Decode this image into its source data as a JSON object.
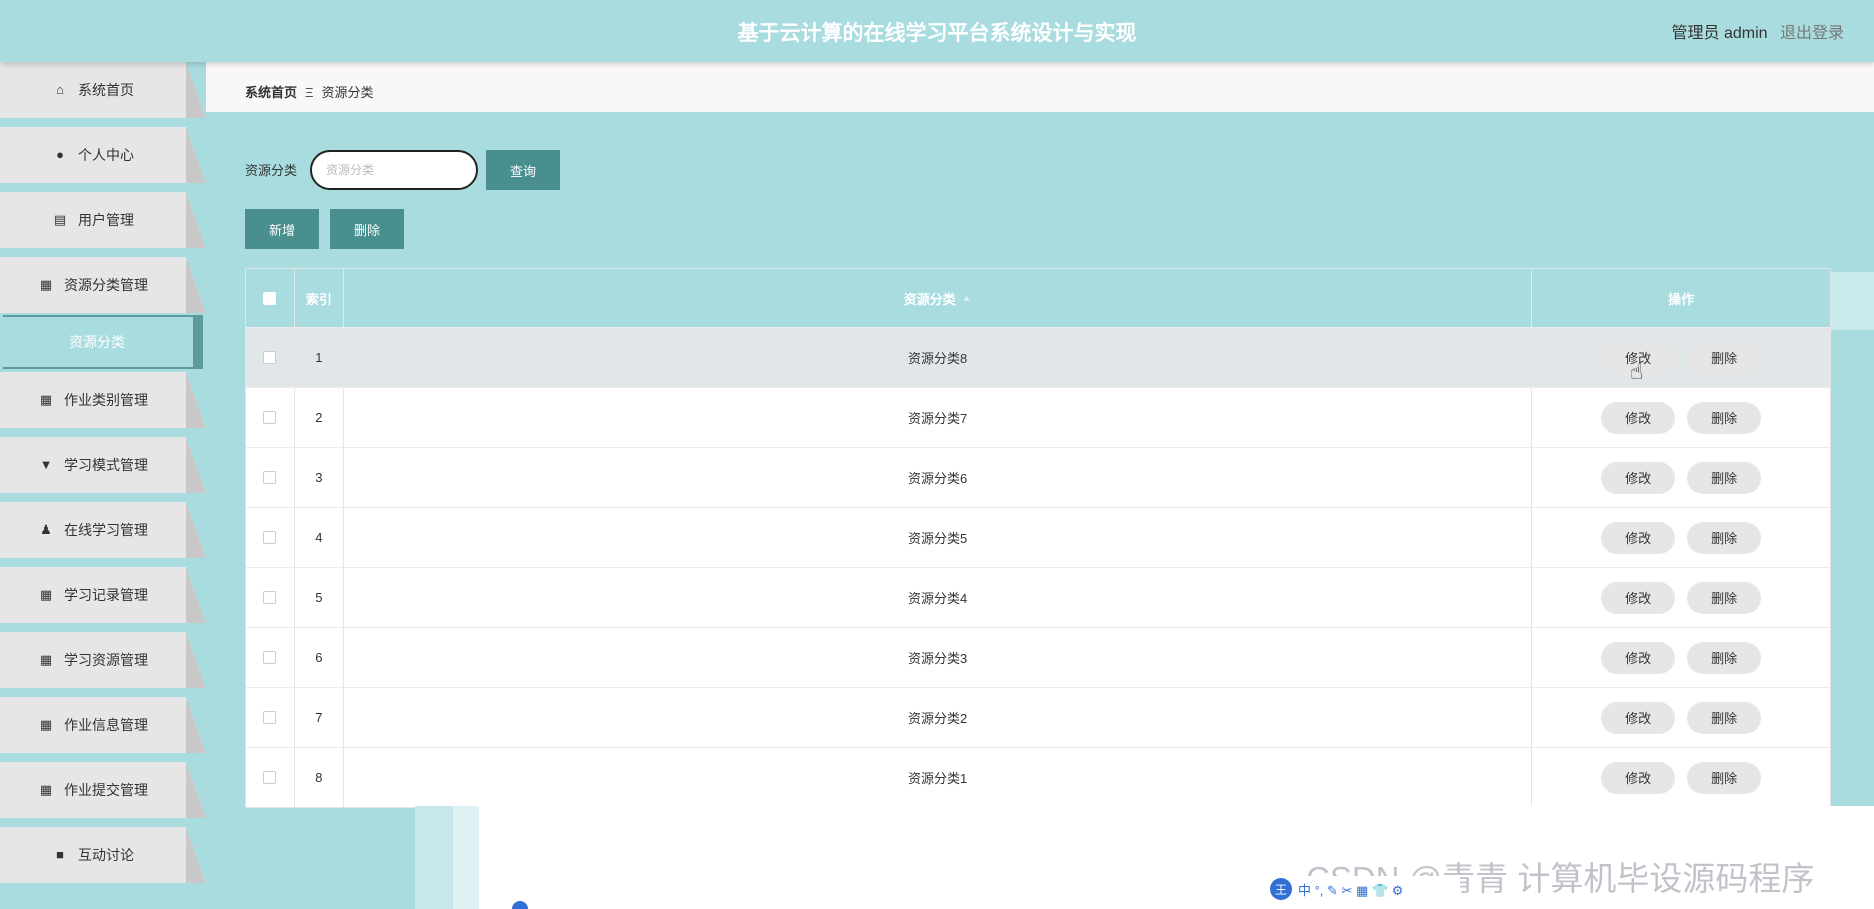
{
  "header": {
    "title": "基于云计算的在线学习平台系统设计与实现",
    "user_text": "管理员 admin",
    "logout": "退出登录"
  },
  "sidebar": {
    "items": [
      {
        "label": "系统首页",
        "icon": "home-icon"
      },
      {
        "label": "个人中心",
        "icon": "user-icon"
      },
      {
        "label": "用户管理",
        "icon": "chart-icon"
      },
      {
        "label": "资源分类管理",
        "icon": "grid-icon"
      },
      {
        "label": "作业类别管理",
        "icon": "grid-icon"
      },
      {
        "label": "学习模式管理",
        "icon": "pin-icon"
      },
      {
        "label": "在线学习管理",
        "icon": "person-icon"
      },
      {
        "label": "学习记录管理",
        "icon": "grid-icon"
      },
      {
        "label": "学习资源管理",
        "icon": "grid-icon"
      },
      {
        "label": "作业信息管理",
        "icon": "grid-icon"
      },
      {
        "label": "作业提交管理",
        "icon": "grid-icon"
      },
      {
        "label": "互动讨论",
        "icon": "video-icon"
      }
    ],
    "active_sub": "资源分类"
  },
  "breadcrumb": {
    "home": "系统首页",
    "separator": "Ξ",
    "current": "资源分类"
  },
  "search": {
    "label": "资源分类",
    "placeholder": "资源分类",
    "button": "查询"
  },
  "actions": {
    "add": "新增",
    "delete": "删除"
  },
  "table": {
    "columns": {
      "index": "索引",
      "name": "资源分类",
      "ops": "操作"
    },
    "edit_label": "修改",
    "delete_label": "删除",
    "rows": [
      {
        "index": "1",
        "name": "资源分类8"
      },
      {
        "index": "2",
        "name": "资源分类7"
      },
      {
        "index": "3",
        "name": "资源分类6"
      },
      {
        "index": "4",
        "name": "资源分类5"
      },
      {
        "index": "5",
        "name": "资源分类4"
      },
      {
        "index": "6",
        "name": "资源分类3"
      },
      {
        "index": "7",
        "name": "资源分类2"
      },
      {
        "index": "8",
        "name": "资源分类1"
      }
    ]
  },
  "watermark": "CSDN @青青 计算机毕设源码程序",
  "ime": {
    "logo": "王",
    "text": "中 °, ✎ ✂ ▦ 👕 ⚙"
  },
  "colors": {
    "accent": "#a8dcdf",
    "button": "#4a8f8f",
    "active_border": "#5c9a9c"
  }
}
